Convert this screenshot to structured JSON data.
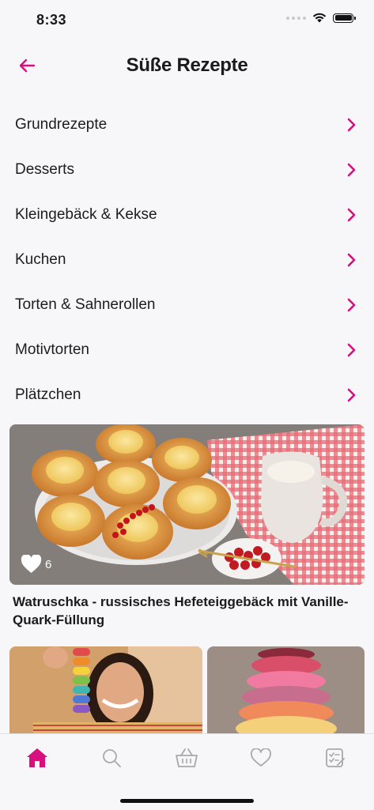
{
  "status_bar": {
    "time": "8:33"
  },
  "header": {
    "title": "Süße Rezepte"
  },
  "categories": [
    {
      "label": "Grundrezepte"
    },
    {
      "label": "Desserts"
    },
    {
      "label": "Kleingebäck & Kekse"
    },
    {
      "label": "Kuchen"
    },
    {
      "label": "Torten & Sahnerollen"
    },
    {
      "label": "Motivtorten"
    },
    {
      "label": "Plätzchen"
    }
  ],
  "featured_recipe": {
    "title": "Watruschka - russisches Hefeteiggebäck mit Vanille-Quark-Füllung",
    "likes": "6"
  },
  "colors": {
    "accent": "#d6107e",
    "background": "#f7f6f8",
    "text": "#1b1b1b",
    "inactive_icon": "#a9a9a9"
  },
  "tab_bar": {
    "items": [
      {
        "icon": "home-icon",
        "active": true
      },
      {
        "icon": "search-icon",
        "active": false
      },
      {
        "icon": "basket-icon",
        "active": false
      },
      {
        "icon": "heart-icon",
        "active": false
      },
      {
        "icon": "checklist-icon",
        "active": false
      }
    ]
  }
}
